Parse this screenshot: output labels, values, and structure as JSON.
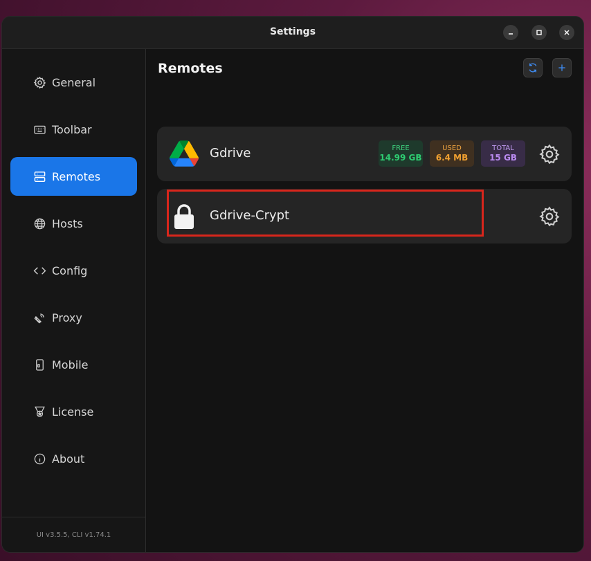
{
  "window": {
    "title": "Settings"
  },
  "sidebar": {
    "items": [
      {
        "label": "General",
        "icon": "gear-icon"
      },
      {
        "label": "Toolbar",
        "icon": "keyboard-icon"
      },
      {
        "label": "Remotes",
        "icon": "server-icon",
        "active": true
      },
      {
        "label": "Hosts",
        "icon": "globe-icon"
      },
      {
        "label": "Config",
        "icon": "code-icon"
      },
      {
        "label": "Proxy",
        "icon": "satellite-icon"
      },
      {
        "label": "Mobile",
        "icon": "mobile-icon"
      },
      {
        "label": "License",
        "icon": "medal-icon"
      },
      {
        "label": "About",
        "icon": "info-icon"
      }
    ],
    "version": "UI v3.5.5, CLI v1.74.1"
  },
  "main": {
    "title": "Remotes",
    "remotes": [
      {
        "name": "Gdrive",
        "icon": "google-drive-icon",
        "stats": {
          "free_label": "FREE",
          "free_value": "14.99 GB",
          "used_label": "USED",
          "used_value": "6.4 MB",
          "total_label": "TOTAL",
          "total_value": "15 GB"
        }
      },
      {
        "name": "Gdrive-Crypt",
        "icon": "lock-icon"
      }
    ]
  },
  "colors": {
    "accent": "#1a76e8",
    "highlight": "#d9261c",
    "free": "#2ecc71",
    "used": "#f0a030",
    "total": "#b98af0"
  }
}
